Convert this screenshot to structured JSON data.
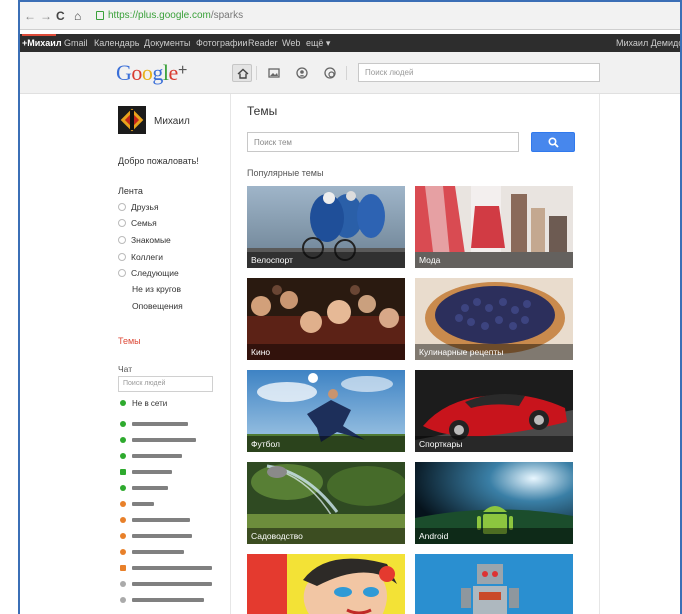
{
  "browser": {
    "url_prefix": "https://",
    "url_host": "plus.google.com",
    "url_path": "/sparks"
  },
  "gbar": {
    "items": [
      "+Михаил",
      "Gmail",
      "Календарь",
      "Документы",
      "Фотографии",
      "Reader",
      "Web",
      "ещё ▾"
    ],
    "user": "Михаил Демидов"
  },
  "header": {
    "logo_letters": [
      "G",
      "o",
      "o",
      "g",
      "l",
      "e"
    ],
    "logo_plus": "+",
    "search_placeholder": "Поиск людей"
  },
  "sidebar": {
    "profile_name": "Михаил",
    "welcome": "Добро пожаловать!",
    "stream_heading": "Лента",
    "circles": [
      {
        "label": "Друзья"
      },
      {
        "label": "Семья"
      },
      {
        "label": "Знакомые"
      },
      {
        "label": "Коллеги"
      },
      {
        "label": "Следующие"
      }
    ],
    "subitems": [
      "Не из кругов",
      "Оповещения"
    ],
    "themes_link": "Темы",
    "chat_heading": "Чат",
    "chat_search_placeholder": "Поиск людей",
    "chat_first": "Не в сети"
  },
  "main": {
    "title": "Темы",
    "search_placeholder": "Поиск тем",
    "popular_heading": "Популярные темы",
    "tiles": [
      {
        "label": "Велоспорт"
      },
      {
        "label": "Мода"
      },
      {
        "label": "Кино"
      },
      {
        "label": "Кулинарные рецепты"
      },
      {
        "label": "Футбол"
      },
      {
        "label": "Спорткары"
      },
      {
        "label": "Садоводство"
      },
      {
        "label": "Android"
      },
      {
        "label": ""
      },
      {
        "label": ""
      }
    ]
  },
  "colors": {
    "accent_blue": "#4787ed",
    "themes_red": "#dd4b39",
    "online_green": "#2eaa2e",
    "idle_orange": "#e8802a"
  }
}
